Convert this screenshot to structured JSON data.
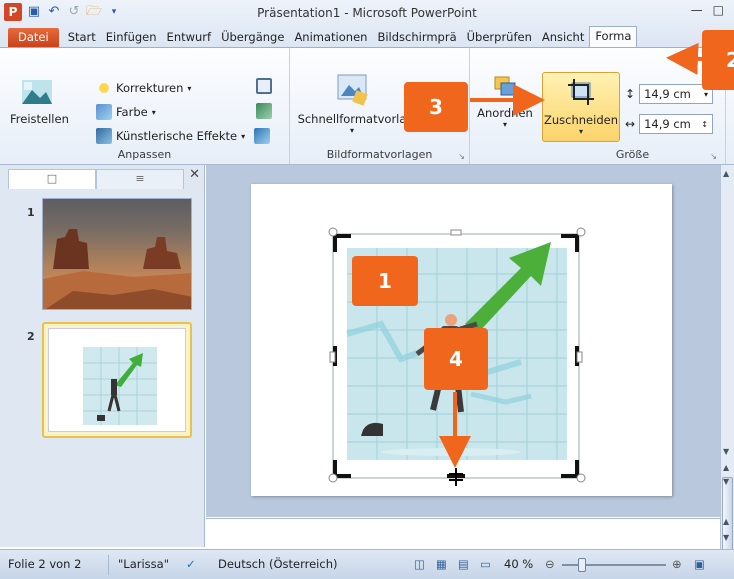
{
  "window": {
    "title": "Präsentation1 - Microsoft PowerPoint"
  },
  "tabs": [
    "Datei",
    "Start",
    "Einfügen",
    "Entwurf",
    "Übergänge",
    "Animationen",
    "Bildschirmprä",
    "Überprüfen",
    "Ansicht",
    "Forma"
  ],
  "ribbon": {
    "freistellen": "Freistellen",
    "korrekturen": "Korrekturen",
    "farbe": "Farbe",
    "kuenstlerisch": "Künstlerische Effekte",
    "anpassen": "Anpassen",
    "schnellformat": "Schnellformatvorla",
    "bildformatvorlagen": "Bildformatvorlagen",
    "anordnen": "Anordnen",
    "zuschneiden": "Zuschneiden",
    "hoehe": "14,9 cm",
    "breite": "14,9 cm",
    "groesse": "Größe"
  },
  "slides_pane": {
    "slide1_num": "1",
    "slide2_num": "2"
  },
  "status": {
    "folie": "Folie 2 von 2",
    "theme": "\"Larissa\"",
    "language": "Deutsch (Österreich)",
    "zoom": "40 %"
  },
  "callouts": {
    "c1": "1",
    "c2": "2",
    "c3": "3",
    "c4": "4"
  },
  "colors": {
    "accent": "#f0661d",
    "datei_tab": "#d24726",
    "arrow_green": "#4caf3a"
  }
}
